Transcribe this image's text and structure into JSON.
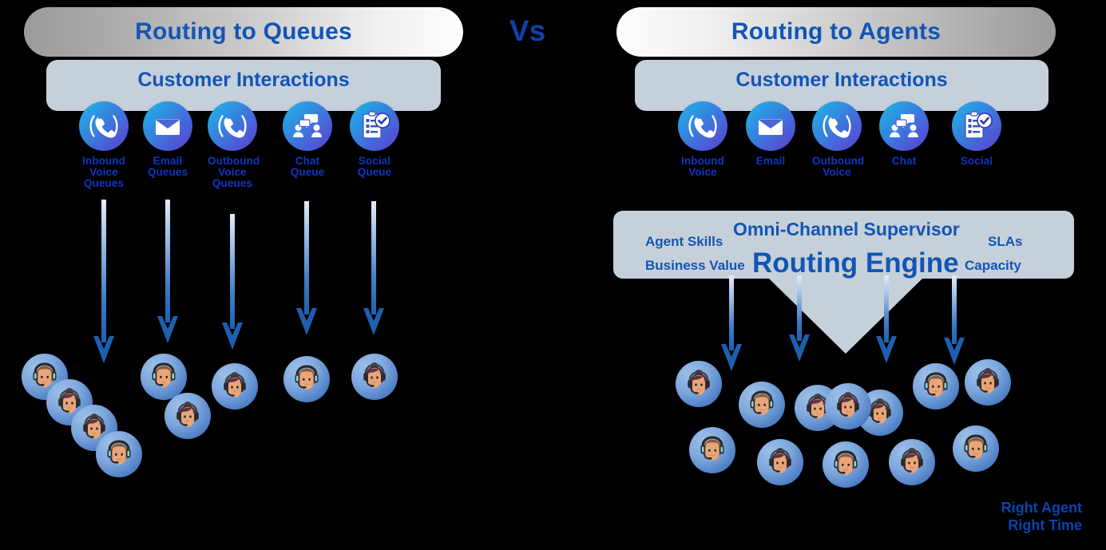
{
  "background": "#000000",
  "accent_blue": "#1255b5",
  "label_blue": "#1134c4",
  "panel_gray": "#c6d0da",
  "vs_label": "Vs",
  "left": {
    "title": "Routing to Queues",
    "panel_title": "Customer Interactions",
    "channels": [
      {
        "icon": "inbound-call-icon",
        "label": "Inbound\nVoice\nQueues"
      },
      {
        "icon": "email-icon",
        "label": "Email\nQueues"
      },
      {
        "icon": "outbound-call-icon",
        "label": "Outbound\nVoice\nQueues"
      },
      {
        "icon": "chat-icon",
        "label": "Chat\nQueue"
      },
      {
        "icon": "social-icon",
        "label": "Social\nQueue"
      }
    ],
    "arrow_count": 5,
    "agent_count": 9
  },
  "right": {
    "title": "Routing to Agents",
    "panel_title": "Customer Interactions",
    "channels": [
      {
        "icon": "inbound-call-icon",
        "label": "Inbound\nVoice"
      },
      {
        "icon": "email-icon",
        "label": "Email"
      },
      {
        "icon": "outbound-call-icon",
        "label": "Outbound\nVoice"
      },
      {
        "icon": "chat-icon",
        "label": "Chat"
      },
      {
        "icon": "social-icon",
        "label": "Social"
      }
    ],
    "engine": {
      "supervisor": "Omni-Channel Supervisor",
      "name": "Routing Engine",
      "attr_left_top": "Agent Skills",
      "attr_left_bottom": "Business Value",
      "attr_right_top": "SLAs",
      "attr_right_bottom": "Capacity"
    },
    "arrow_count": 4,
    "agent_count": 12,
    "outcome_line1": "Right Agent",
    "outcome_line2": "Right Time"
  }
}
